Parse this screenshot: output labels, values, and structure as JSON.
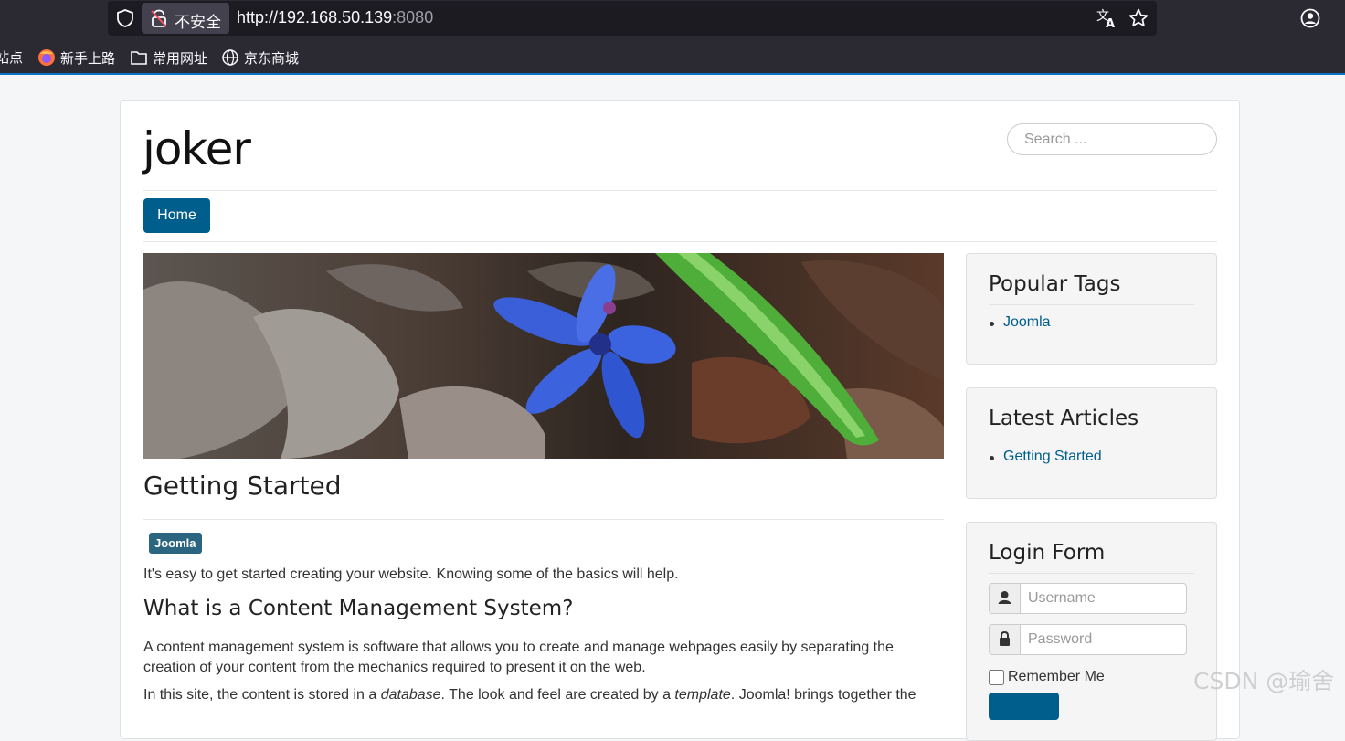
{
  "browser": {
    "insecure_label": "不安全",
    "url_main": "http://192.168.50.139",
    "url_port": ":8080",
    "bookmarks": [
      {
        "label": "站点",
        "icon": "none"
      },
      {
        "label": "新手上路",
        "icon": "firefox-icon"
      },
      {
        "label": "常用网址",
        "icon": "folder-icon"
      },
      {
        "label": "京东商城",
        "icon": "globe-icon"
      }
    ]
  },
  "site": {
    "brand": "joker",
    "search_placeholder": "Search ...",
    "nav": {
      "home": "Home"
    }
  },
  "article": {
    "title": "Getting Started",
    "tag": "Joomla",
    "intro": "It's easy to get started creating your website. Knowing some of the basics will help.",
    "heading": "What is a Content Management System?",
    "para": "A content management system is software that allows you to create and manage webpages easily by separating the creation of your content from the mechanics required to present it on the web.",
    "para2_a": "In this site, the content is stored in a ",
    "para2_b": "database",
    "para2_c": ". The look and feel are created by a ",
    "para2_d": "template",
    "para2_e": ". Joomla! brings together the"
  },
  "sidebar": {
    "popular_tags": {
      "title": "Popular Tags",
      "item": "Joomla"
    },
    "latest_articles": {
      "title": "Latest Articles",
      "item": "Getting Started"
    },
    "login": {
      "title": "Login Form",
      "username_placeholder": "Username",
      "password_placeholder": "Password",
      "remember": "Remember Me"
    }
  },
  "watermark": "CSDN @瑜舍"
}
